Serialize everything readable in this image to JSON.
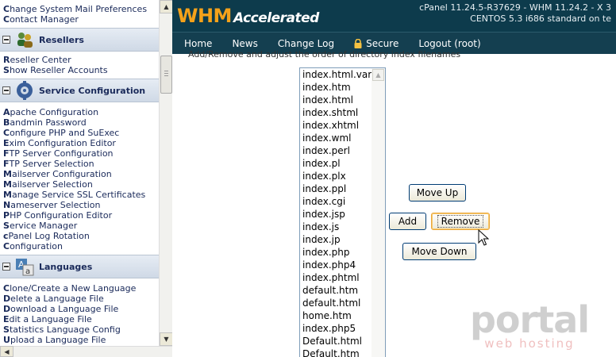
{
  "sidebar": {
    "top_links": [
      "Change System Mail Preferences",
      "Contact Manager"
    ],
    "sections": [
      {
        "title": "Resellers",
        "icon": "resellers-icon",
        "links": [
          "Reseller Center",
          "Show Reseller Accounts"
        ]
      },
      {
        "title": "Service Configuration",
        "icon": "service-config-icon",
        "links": [
          "Apache Configuration",
          "Bandmin Password",
          "Configure PHP and SuExec",
          "Exim Configuration Editor",
          "FTP Server Configuration",
          "FTP Server Selection",
          "Mailserver Configuration",
          "Mailserver Selection",
          "Manage Service SSL Certificates",
          "Nameserver Selection",
          "PHP Configuration Editor",
          "Service Manager",
          "cPanel Log Rotation",
          "Configuration"
        ]
      },
      {
        "title": "Languages",
        "icon": "languages-icon",
        "links": [
          "Clone/Create a New Language",
          "Delete a Language File",
          "Download a Language File",
          "Edit a Language File",
          "Statistics Language Config",
          "Upload a Language File"
        ]
      }
    ]
  },
  "header": {
    "logo_main": "WHM",
    "logo_sub": "Accelerated",
    "version_line1": "cPanel 11.24.5-R37629 - WHM 11.24.2 - X 3",
    "version_line2": "CENTOS 5.3 i686 standard on te"
  },
  "nav": {
    "home": "Home",
    "news": "News",
    "changelog": "Change Log",
    "secure": "Secure",
    "logout": "Logout (root)"
  },
  "main": {
    "instruction": "Add/Remove and adjust the order of directory index filenames",
    "index_files": [
      "index.html.var",
      "index.htm",
      "index.html",
      "index.shtml",
      "index.xhtml",
      "index.wml",
      "index.perl",
      "index.pl",
      "index.plx",
      "index.ppl",
      "index.cgi",
      "index.jsp",
      "index.js",
      "index.jp",
      "index.php",
      "index.php4",
      "index.phtml",
      "default.htm",
      "default.html",
      "home.htm",
      "index.php5",
      "Default.html",
      "Default.htm"
    ],
    "buttons": {
      "move_up": "Move Up",
      "add": "Add",
      "remove": "Remove",
      "move_down": "Move Down"
    }
  },
  "watermark": {
    "main": "portal",
    "sub": "web hosting"
  },
  "colors": {
    "header_bg": "#0d3b4c",
    "logo_orange": "#f5a21a",
    "link": "#1a2a5a"
  }
}
